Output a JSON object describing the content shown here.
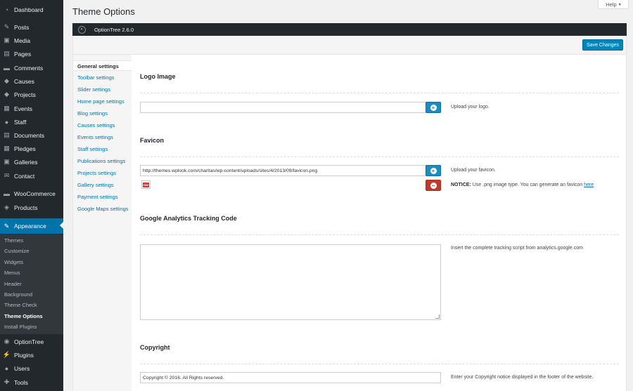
{
  "sidebar": {
    "items": [
      {
        "label": "Dashboard",
        "icon": "dashboard-icon",
        "glyph": "◔"
      },
      {
        "label": "Posts",
        "icon": "pin-icon",
        "glyph": "✎"
      },
      {
        "label": "Media",
        "icon": "media-icon",
        "glyph": "▣"
      },
      {
        "label": "Pages",
        "icon": "pages-icon",
        "glyph": "▤"
      },
      {
        "label": "Comments",
        "icon": "comment-icon",
        "glyph": "▬"
      },
      {
        "label": "Causes",
        "icon": "causes-icon",
        "glyph": "◆"
      },
      {
        "label": "Projects",
        "icon": "projects-icon",
        "glyph": "◆"
      },
      {
        "label": "Events",
        "icon": "events-icon",
        "glyph": "▦"
      },
      {
        "label": "Staff",
        "icon": "staff-icon",
        "glyph": "●"
      },
      {
        "label": "Documents",
        "icon": "documents-icon",
        "glyph": "▤"
      },
      {
        "label": "Pledges",
        "icon": "pledges-icon",
        "glyph": "▦"
      },
      {
        "label": "Galleries",
        "icon": "galleries-icon",
        "glyph": "▣"
      },
      {
        "label": "Contact",
        "icon": "contact-icon",
        "glyph": "✉"
      },
      {
        "label": "WooCommerce",
        "icon": "woocommerce-icon",
        "glyph": "▬"
      },
      {
        "label": "Products",
        "icon": "products-icon",
        "glyph": "◈"
      },
      {
        "label": "Appearance",
        "icon": "appearance-icon",
        "glyph": "✎"
      },
      {
        "label": "OptionTree",
        "icon": "optiontree-icon",
        "glyph": "◉"
      },
      {
        "label": "Plugins",
        "icon": "plugins-icon",
        "glyph": "⚡"
      },
      {
        "label": "Users",
        "icon": "users-icon",
        "glyph": "●"
      },
      {
        "label": "Tools",
        "icon": "tools-icon",
        "glyph": "✚"
      }
    ],
    "submenu": [
      "Themes",
      "Customize",
      "Widgets",
      "Menus",
      "Header",
      "Background",
      "Theme Check",
      "Theme Options",
      "Install Plugins"
    ]
  },
  "page": {
    "title": "Theme Options",
    "help_label": "Help",
    "help_arrow": "▾"
  },
  "optiontree": {
    "header_label": "OptionTree 2.6.0",
    "save_label": "Save Changes"
  },
  "tabs": [
    "General settings",
    "Toolbar settings",
    "Slider settings",
    "Home page settings",
    "Blog settings",
    "Causes settings",
    "Events settings",
    "Staff settings",
    "Publications settings",
    "Projects settings",
    "Gallery settings",
    "Payment settings",
    "Google Maps settings"
  ],
  "sections": {
    "logo": {
      "title": "Logo Image",
      "value": "",
      "desc": "Upload your logo."
    },
    "favicon": {
      "title": "Favicon",
      "value": "http://themes.wplook.com/charitas/wp-content/uploads/sites/4/2013/09/favicon.png",
      "desc": "Upload your favicon.",
      "notice_label": "NOTICE:",
      "notice_text": " Use .png image type. You can generate an favicon ",
      "notice_link": "here",
      "thumb_text": "DW"
    },
    "analytics": {
      "title": "Google Analytics Tracking Code",
      "value": "",
      "desc": "Insert the complete tracking script from analytics.google.com"
    },
    "copyright": {
      "title": "Copyright",
      "value": "Copyright © 2016. All Rights reserved.",
      "desc": "Enter your Copyright notice displayed in the footer of the website."
    }
  },
  "colors": {
    "sidebar_bg": "#23282d",
    "accent": "#0073aa",
    "button_blue": "#1e8cbe",
    "button_red": "#c0392b"
  }
}
